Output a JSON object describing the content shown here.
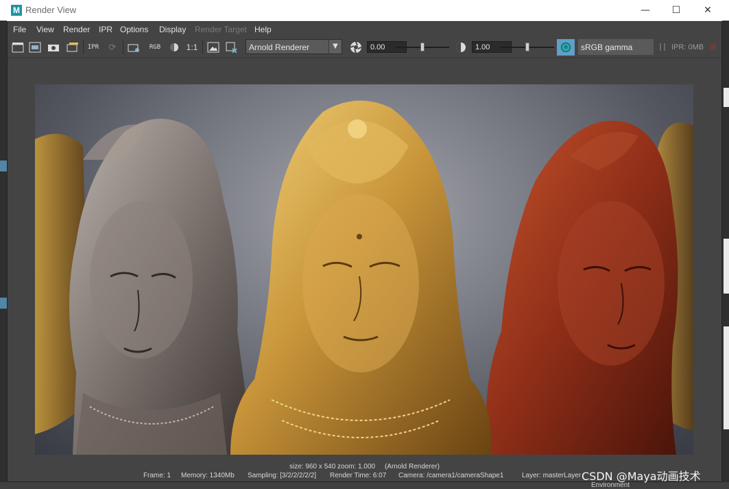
{
  "window": {
    "title": "Render View",
    "app_icon_letter": "M"
  },
  "menus": [
    {
      "label": "File",
      "disabled": false
    },
    {
      "label": "View",
      "disabled": false
    },
    {
      "label": "Render",
      "disabled": false
    },
    {
      "label": "IPR",
      "disabled": false
    },
    {
      "label": "Options",
      "disabled": false
    },
    {
      "label": "Display",
      "disabled": false
    },
    {
      "label": "Render Target",
      "disabled": true
    },
    {
      "label": "Help",
      "disabled": false
    }
  ],
  "toolbar": {
    "rgb_label": "RGB",
    "ratio_label": "1:1",
    "ipr_label": "IPR",
    "renderer": "Arnold Renderer",
    "exposure_value": "0.00",
    "gamma_value": "1.00",
    "colorspace": "sRGB gamma",
    "ipr_memory": "IPR: 0MB"
  },
  "status": {
    "line1_size": "size: 960 x 540  zoom: 1.000",
    "line1_renderer": "(Arnold Renderer)",
    "frame": "Frame: 1",
    "memory": "Memory: 1340Mb",
    "sampling": "Sampling: [3/2/2/2/2/2]",
    "render_time": "Render Time: 6:07",
    "camera": "Camera: /camera1/cameraShape1",
    "layer": "Layer: masterLayer"
  },
  "watermark": "CSDN @Maya动画技术",
  "bottom_strip_label": "Environment",
  "colors": {
    "accent": "#5ea0c7",
    "gold": "#c8953a",
    "silver": "#8a8482",
    "copper": "#8e2e18"
  }
}
